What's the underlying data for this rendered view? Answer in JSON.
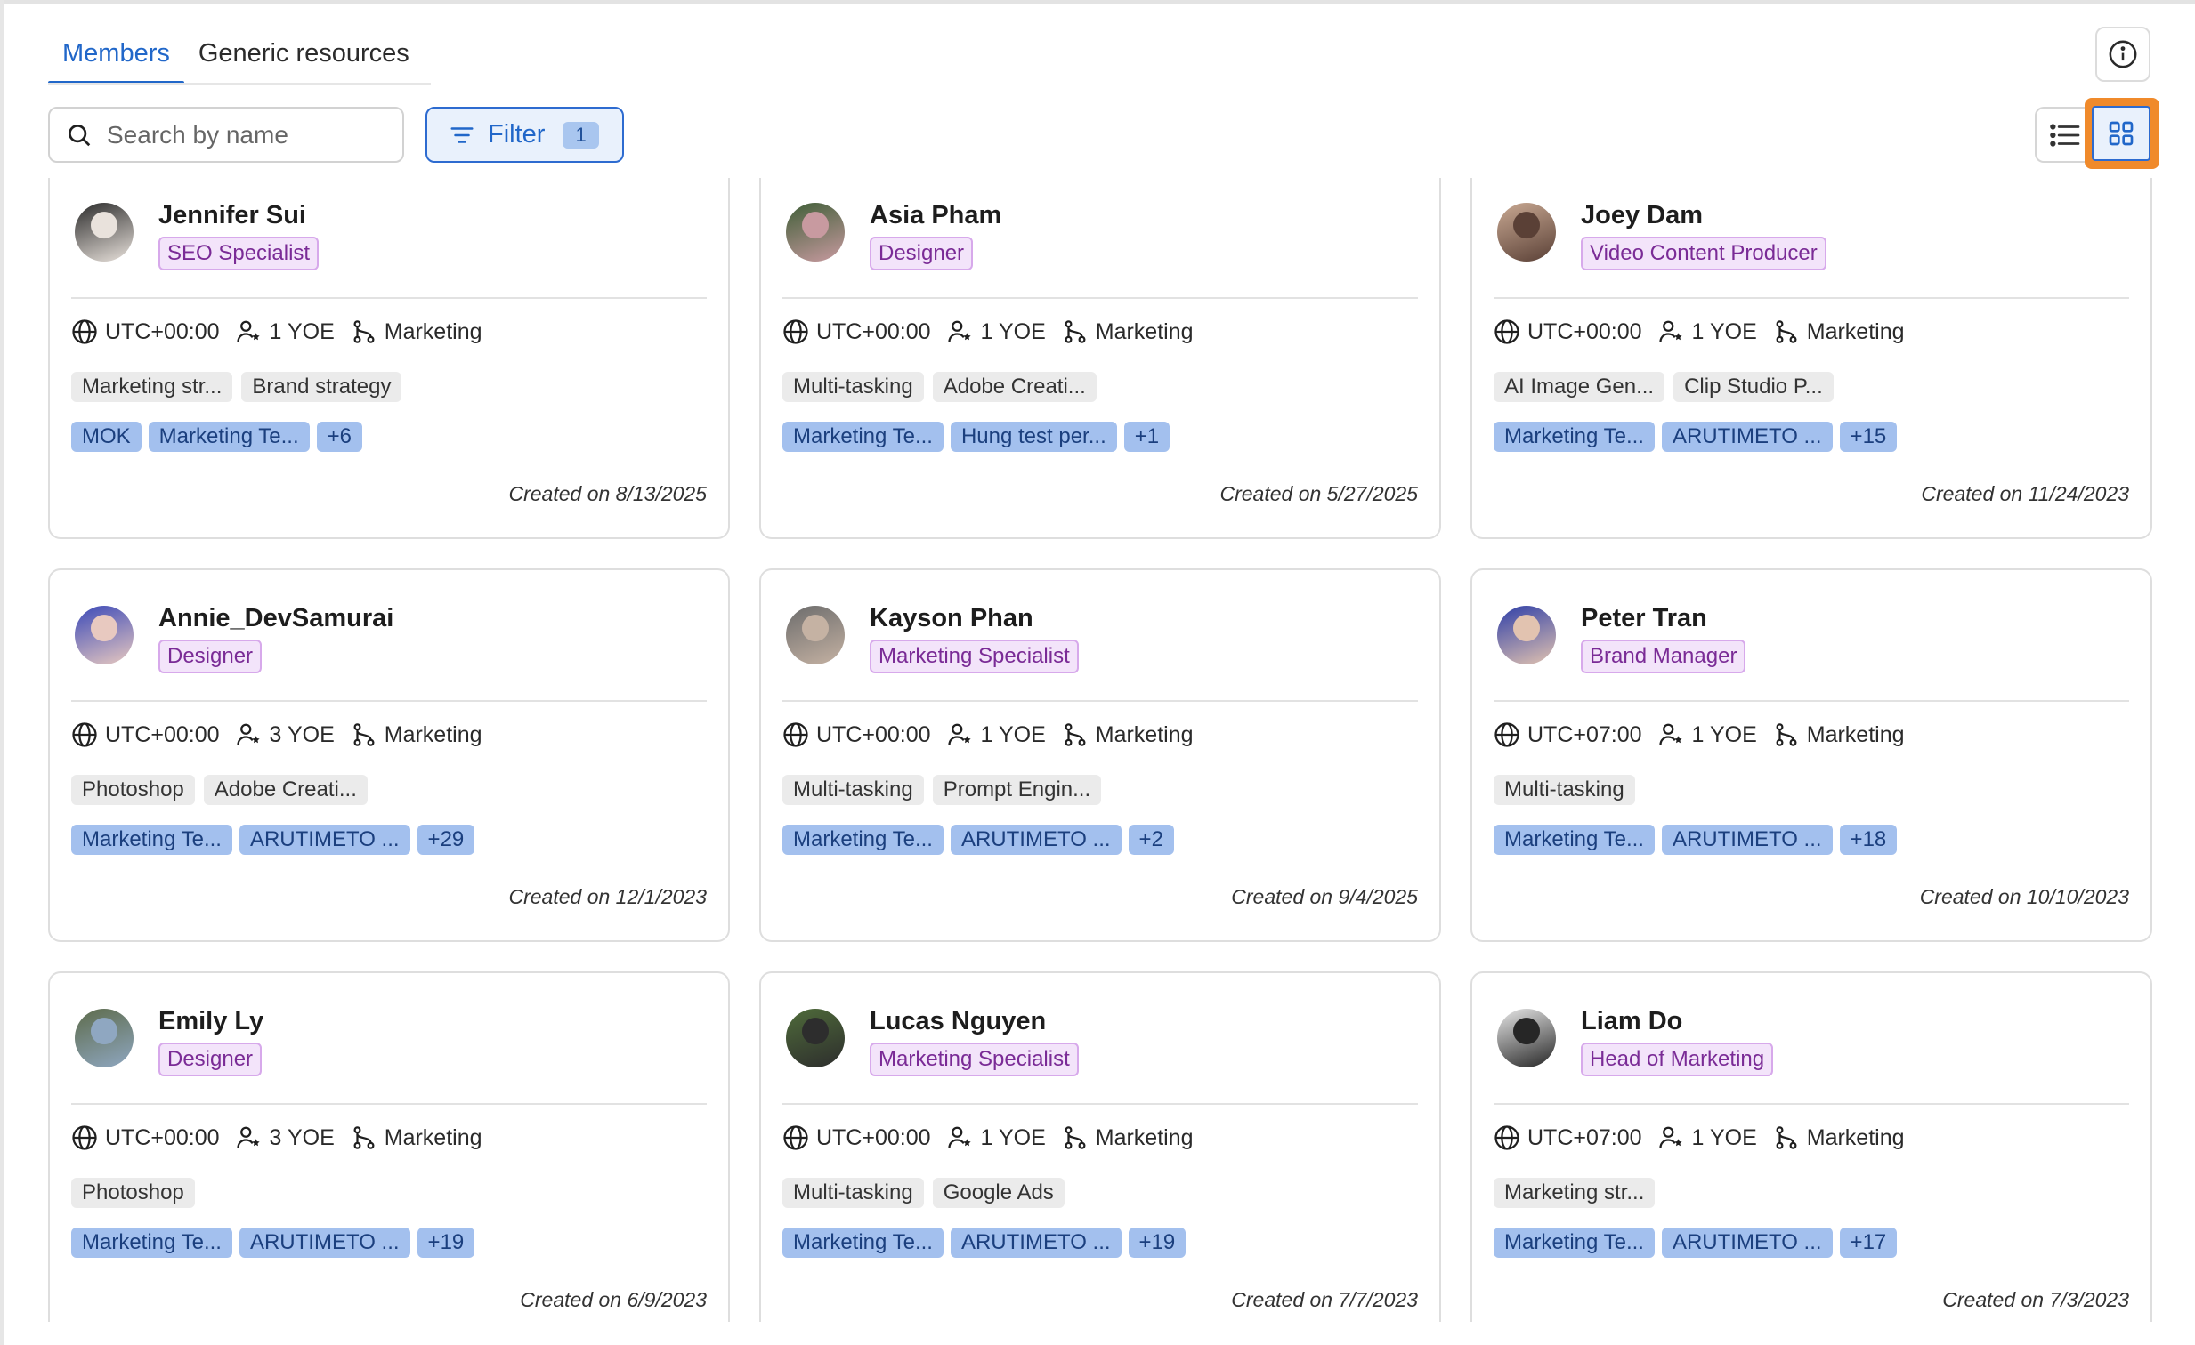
{
  "tabs": {
    "members": "Members",
    "generic": "Generic resources"
  },
  "search": {
    "placeholder": "Search by name"
  },
  "filter": {
    "label": "Filter",
    "count": "1"
  },
  "members": [
    {
      "name": "Jennifer Sui",
      "role": "SEO Specialist",
      "tz": "UTC+00:00",
      "yoe": "1 YOE",
      "dept": "Marketing",
      "skills": [
        "Marketing str...",
        "Brand strategy"
      ],
      "teams": [
        "MOK",
        "Marketing Te...",
        "+6"
      ],
      "created": "Created on 8/13/2025",
      "avatar": [
        "#2b2b2b",
        "#e9e2dc"
      ]
    },
    {
      "name": "Asia Pham",
      "role": "Designer",
      "tz": "UTC+00:00",
      "yoe": "1 YOE",
      "dept": "Marketing",
      "skills": [
        "Multi-tasking",
        "Adobe Creati..."
      ],
      "teams": [
        "Marketing Te...",
        "Hung test per...",
        "+1"
      ],
      "created": "Created on 5/27/2025",
      "avatar": [
        "#3f5e37",
        "#c89aa0"
      ]
    },
    {
      "name": "Joey Dam",
      "role": "Video Content Producer",
      "tz": "UTC+00:00",
      "yoe": "1 YOE",
      "dept": "Marketing",
      "skills": [
        "AI Image Gen...",
        "Clip Studio P..."
      ],
      "teams": [
        "Marketing Te...",
        "ARUTIMETO ...",
        "+15"
      ],
      "created": "Created on 11/24/2023",
      "avatar": [
        "#c9a993",
        "#5a4036"
      ]
    },
    {
      "name": "Annie_DevSamurai",
      "role": "Designer",
      "tz": "UTC+00:00",
      "yoe": "3 YOE",
      "dept": "Marketing",
      "skills": [
        "Photoshop",
        "Adobe Creati..."
      ],
      "teams": [
        "Marketing Te...",
        "ARUTIMETO ...",
        "+29"
      ],
      "created": "Created on 12/1/2023",
      "avatar": [
        "#3b49b8",
        "#e8c9c0"
      ]
    },
    {
      "name": "Kayson Phan",
      "role": "Marketing Specialist",
      "tz": "UTC+00:00",
      "yoe": "1 YOE",
      "dept": "Marketing",
      "skills": [
        "Multi-tasking",
        "Prompt Engin..."
      ],
      "teams": [
        "Marketing Te...",
        "ARUTIMETO ...",
        "+2"
      ],
      "created": "Created on 9/4/2025",
      "avatar": [
        "#6c6c6c",
        "#c5b2a3"
      ]
    },
    {
      "name": "Peter Tran",
      "role": "Brand Manager",
      "tz": "UTC+07:00",
      "yoe": "1 YOE",
      "dept": "Marketing",
      "skills": [
        "Multi-tasking"
      ],
      "teams": [
        "Marketing Te...",
        "ARUTIMETO ...",
        "+18"
      ],
      "created": "Created on 10/10/2023",
      "avatar": [
        "#2f3fa8",
        "#e2c3b0"
      ]
    },
    {
      "name": "Emily Ly",
      "role": "Designer",
      "tz": "UTC+00:00",
      "yoe": "3 YOE",
      "dept": "Marketing",
      "skills": [
        "Photoshop"
      ],
      "teams": [
        "Marketing Te...",
        "ARUTIMETO ...",
        "+19"
      ],
      "created": "Created on 6/9/2023",
      "avatar": [
        "#5d6b4b",
        "#8fa7c1"
      ]
    },
    {
      "name": "Lucas Nguyen",
      "role": "Marketing Specialist",
      "tz": "UTC+00:00",
      "yoe": "1 YOE",
      "dept": "Marketing",
      "skills": [
        "Multi-tasking",
        "Google Ads"
      ],
      "teams": [
        "Marketing Te...",
        "ARUTIMETO ...",
        "+19"
      ],
      "created": "Created on 7/7/2023",
      "avatar": [
        "#4f6b3a",
        "#2d2d2d"
      ]
    },
    {
      "name": "Liam Do",
      "role": "Head of Marketing",
      "tz": "UTC+07:00",
      "yoe": "1 YOE",
      "dept": "Marketing",
      "skills": [
        "Marketing str..."
      ],
      "teams": [
        "Marketing Te...",
        "ARUTIMETO ...",
        "+17"
      ],
      "created": "Created on 7/3/2023",
      "avatar": [
        "#e7e7e7",
        "#262626"
      ]
    }
  ],
  "colors": {
    "accent": "#2167c9",
    "highlight": "#f08a2b",
    "role_bg": "#f3e4fa",
    "team_bg": "#a3c0ee"
  },
  "icons": {
    "info": "info-icon",
    "search": "search-icon",
    "filter": "filter-icon",
    "list": "list-view-icon",
    "grid": "grid-view-icon",
    "globe": "globe-icon",
    "user": "user-star-icon",
    "dept": "branch-icon"
  }
}
